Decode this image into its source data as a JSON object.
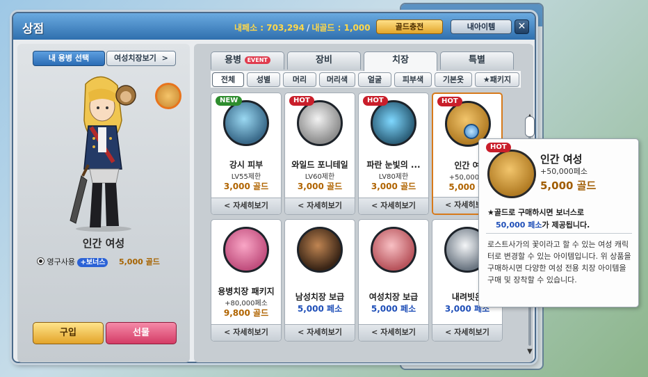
{
  "window": {
    "title": "상점",
    "currency": {
      "points_label": "내페소 : 703,294",
      "gold_label": "내골드 : 1,000"
    },
    "charge_button": "골드충전",
    "my_items_button": "내아이템",
    "close_glyph": "✕"
  },
  "left": {
    "select_button": "내 용병 선택",
    "wardrobe_button": "여성치장보기",
    "wardrobe_chevron": ">",
    "character_name": "인간 여성",
    "option_label": "영구사용",
    "bonus_label": "+보너스",
    "option_price": "5,000 골드",
    "buy_button": "구입",
    "gift_button": "선물"
  },
  "tabs": [
    {
      "label": "용병",
      "badge": "EVENT"
    },
    {
      "label": "장비"
    },
    {
      "label": "치장"
    },
    {
      "label": "특별"
    }
  ],
  "active_tab": "치장",
  "sub_tabs": [
    "전체",
    "성별",
    "머리",
    "머리색",
    "얼굴",
    "피부색",
    "기본옷",
    "★패키지"
  ],
  "active_sub_tab": "전체",
  "items": [
    {
      "badge": "NEW",
      "name": "강시 피부",
      "sub": "LV55제한",
      "price": "3,000 골드",
      "price_color": "gold",
      "detail": "< 자세히보기"
    },
    {
      "badge": "HOT",
      "name": "와일드 포니테일",
      "sub": "LV60제한",
      "price": "3,000 골드",
      "price_color": "gold",
      "detail": "< 자세히보기"
    },
    {
      "badge": "HOT",
      "name": "파란 눈빛의 ...",
      "sub": "LV80제한",
      "price": "3,000 골드",
      "price_color": "gold",
      "detail": "< 자세히보기"
    },
    {
      "badge": "HOT",
      "name": "인간 여",
      "sub": "+50,000페",
      "price": "5,000 골",
      "price_color": "gold",
      "detail": "< 자세히보기",
      "selected": true
    },
    {
      "badge": "",
      "name": "용병치장 패키지",
      "sub": "+80,000페소",
      "price": "9,800 골드",
      "price_color": "gold",
      "detail": "< 자세히보기"
    },
    {
      "badge": "",
      "name": "남성치장 보급",
      "sub": "",
      "price": "5,000 페소",
      "price_color": "blue",
      "detail": "< 자세히보기"
    },
    {
      "badge": "",
      "name": "여성치장 보급",
      "sub": "",
      "price": "5,000 페소",
      "price_color": "blue",
      "detail": "< 자세히보기"
    },
    {
      "badge": "",
      "name": "내려빗은",
      "sub": "",
      "price": "3,000 페소",
      "price_color": "blue",
      "detail": "< 자세히보기"
    }
  ],
  "tooltip": {
    "badge": "HOT",
    "name": "인간 여성",
    "bonus": "+50,000페소",
    "price": "5,000 골드",
    "line1": "★골드로 구매하시면 보너스로",
    "line2_highlight": "50,000 페소",
    "line2_rest": "가 제공됩니다.",
    "description": "로스트사가의 꽃이라고 할 수 있는 여성 캐릭터로 변경할 수 있는 아이템입니다. 위 상품을 구매하시면 다양한 여성 전용 치장 아이템을 구매 및 장착할 수 있습니다."
  },
  "colors": {
    "title_bar": "#2f6fae",
    "gold_price": "#b06400",
    "peso_price": "#1f4fb8",
    "hot_badge": "#c91e2a",
    "new_badge": "#2e8d2e",
    "selected_border": "#d7791a"
  },
  "icons": [
    "close-icon",
    "chevron-right-icon",
    "scroll-up-icon",
    "scroll-down-icon",
    "magnifier-icon"
  ]
}
